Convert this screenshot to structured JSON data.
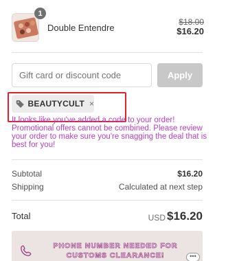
{
  "product": {
    "name": "Double Entendre",
    "quantity": "1",
    "price_original": "$18.00",
    "price_current": "$16.20"
  },
  "discount": {
    "placeholder": "Gift card or discount code",
    "apply_label": "Apply",
    "applied_code": "BEAUTYCULT",
    "remove_symbol": "×",
    "message": "It looks like you've added a code to your order! Promotional offers cannot be combined. Please review your order to make sure you're snagging the deal that is best for you!"
  },
  "summary": {
    "subtotal_label": "Subtotal",
    "subtotal_value": "$16.20",
    "shipping_label": "Shipping",
    "shipping_value": "Calculated at next step",
    "total_label": "Total",
    "currency": "USD",
    "total_value": "$16.20"
  },
  "banner": {
    "text": "PHONE NUMBER NEEDED FOR CUSTOMS CLEARANCE!",
    "chat_symbol": "•••"
  },
  "colors": {
    "promo_message": "#b83fbf",
    "highlight_box": "#e0202a",
    "apply_button": "#c8c8c8",
    "banner_background": "#ebe4e3"
  },
  "icons": [
    "tag-icon",
    "close-icon",
    "phone-icon",
    "chat-bubble-icon"
  ]
}
